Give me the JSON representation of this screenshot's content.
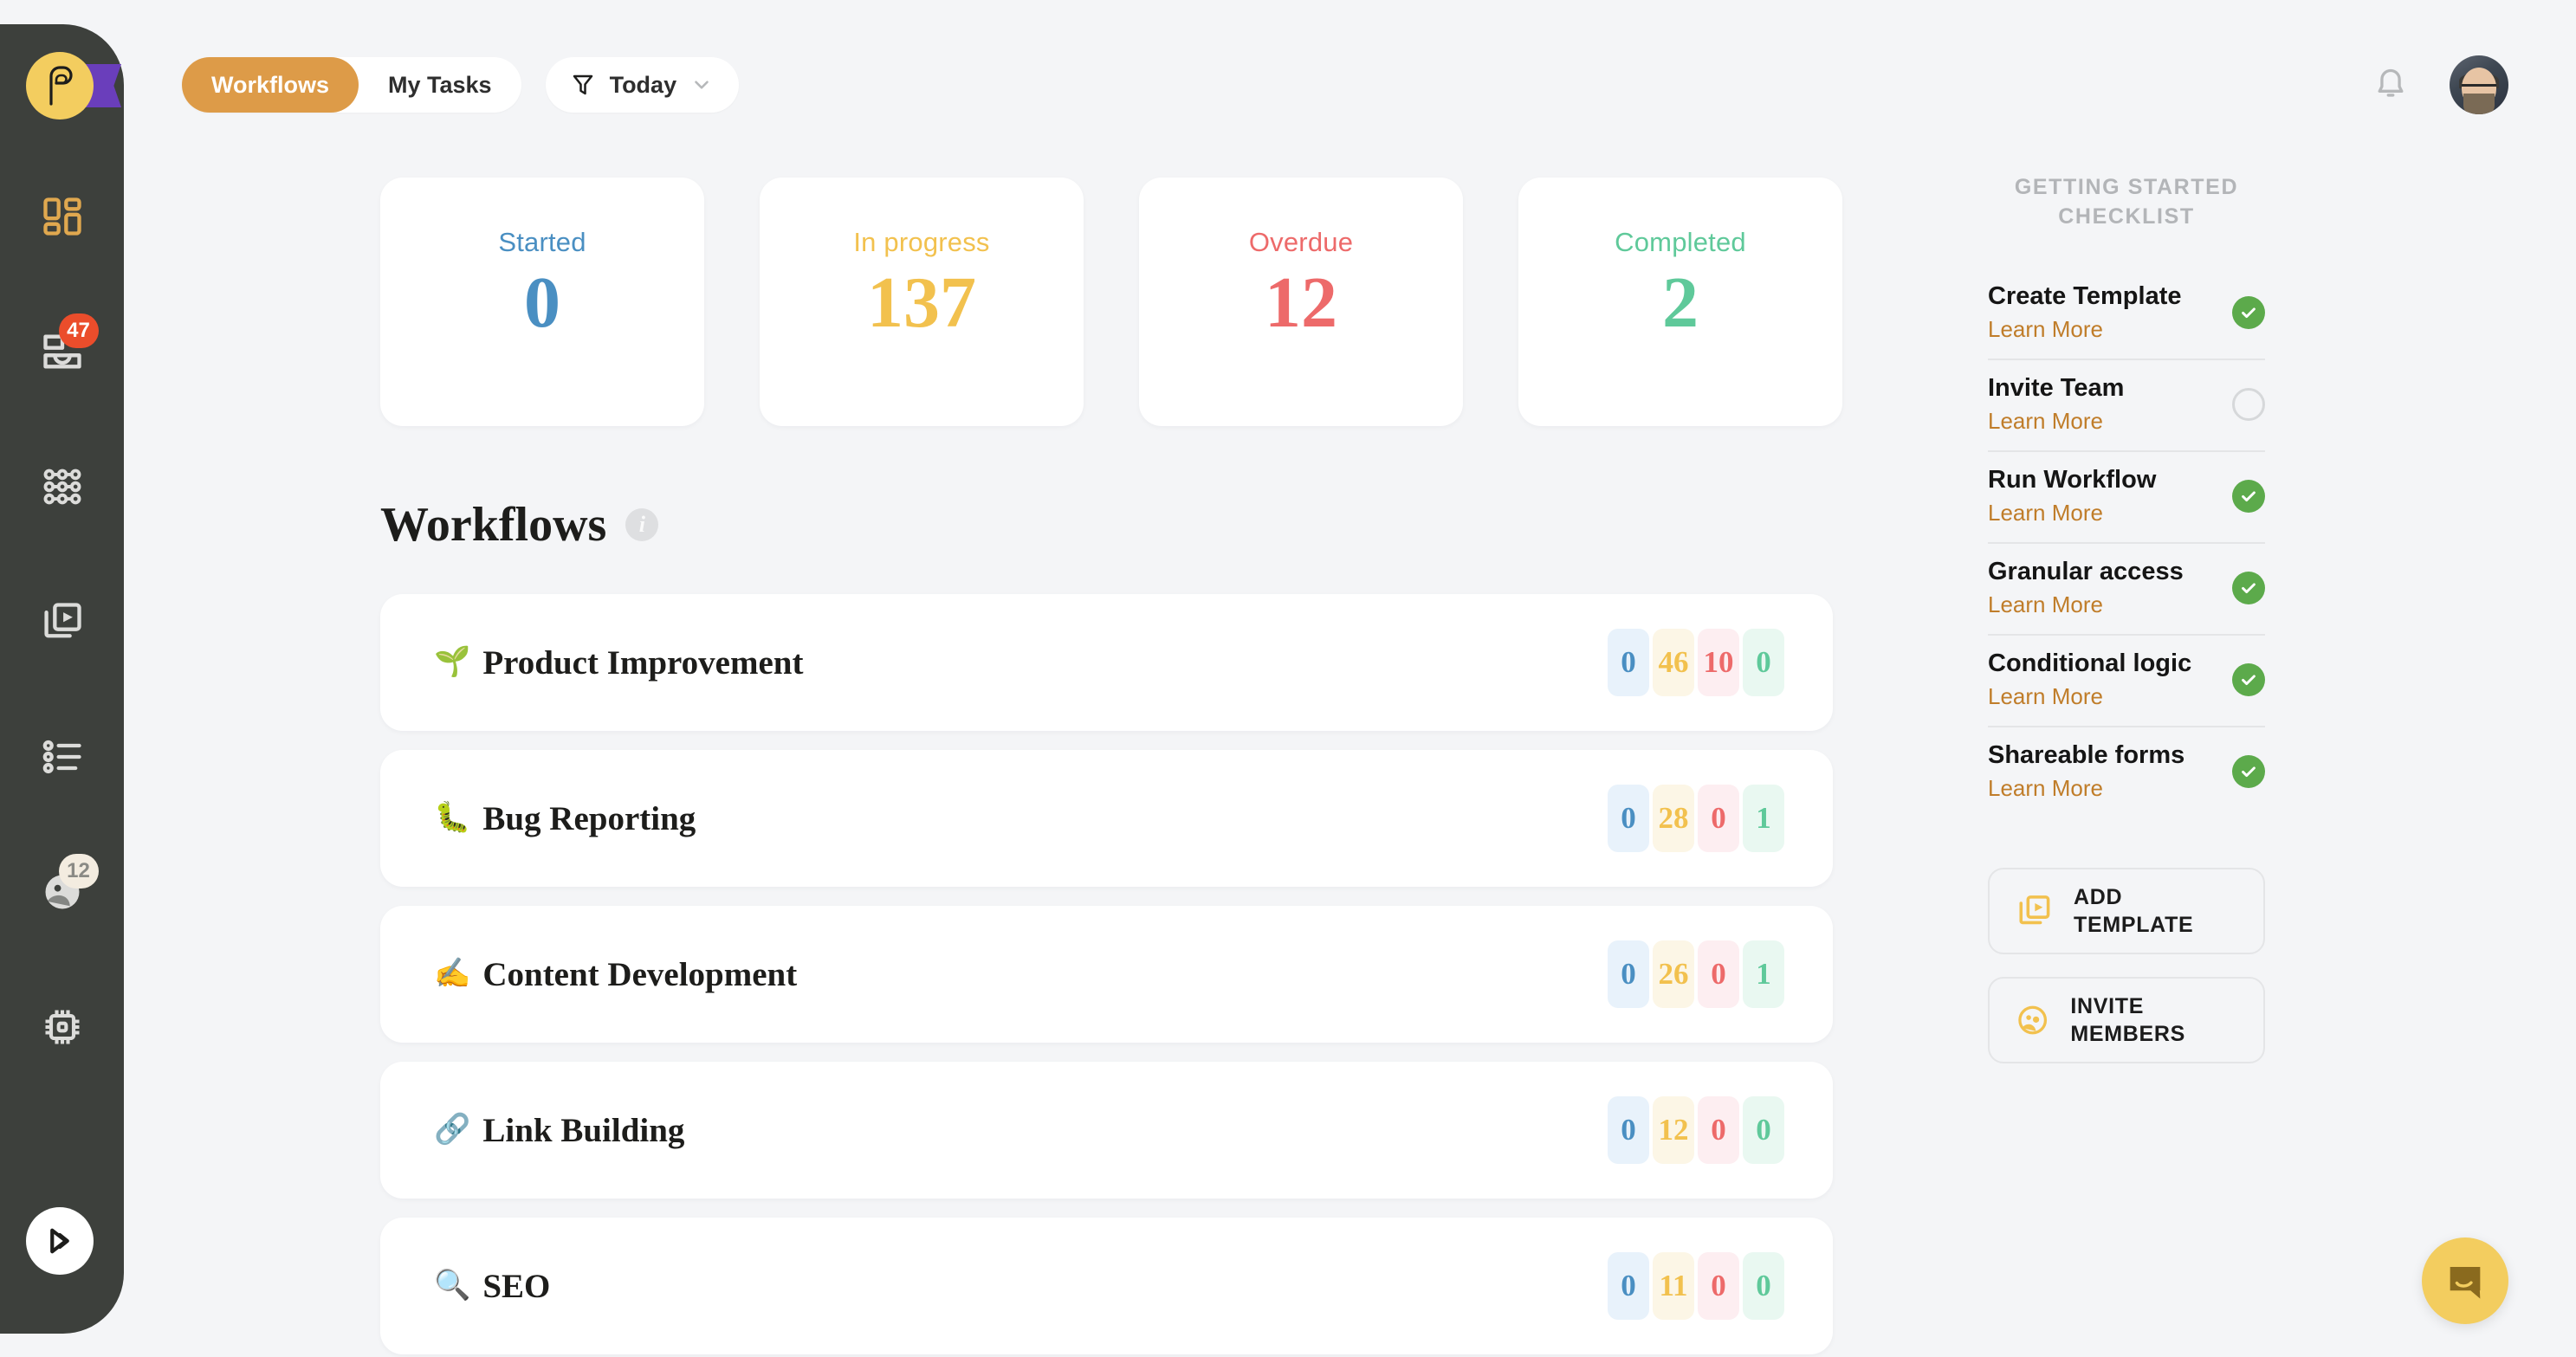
{
  "colors": {
    "sidebar_bg": "#3d403c",
    "page_bg": "#f4f5f7",
    "accent_orange": "#dd9b48",
    "logo_yellow": "#f3cd5f",
    "logo_purple": "#6a3ebb",
    "badge_red": "#eb4d2b",
    "started_blue": "#4a8fc2",
    "inprogress_yellow": "#f2c14e",
    "overdue_red": "#ed6a6a",
    "completed_green": "#5fc99a",
    "check_green": "#5caa4b",
    "link_brown": "#c07d2a"
  },
  "sidebar": {
    "logo": {
      "name": "process-street-logo",
      "letter": "P"
    },
    "items": [
      {
        "icon": "dashboard-grid-icon",
        "label": "Dashboard",
        "active": true,
        "badge": null
      },
      {
        "icon": "inbox-tasks-icon",
        "label": "Inbox",
        "active": false,
        "badge": "47"
      },
      {
        "icon": "workflow-nodes-icon",
        "label": "Workflows",
        "active": false,
        "badge": null
      },
      {
        "icon": "templates-play-icon",
        "label": "Templates",
        "active": false,
        "badge": null
      },
      {
        "icon": "checklist-icon",
        "label": "Checklists",
        "active": false,
        "badge": null
      },
      {
        "icon": "forms-globe-icon",
        "label": "Forms",
        "active": false,
        "badge": "12"
      },
      {
        "icon": "automation-chip-icon",
        "label": "Automations",
        "active": false,
        "badge": null
      }
    ],
    "fab": {
      "icon": "run-play-icon",
      "label": "Run"
    }
  },
  "topbar": {
    "tabs": [
      {
        "label": "Workflows",
        "active": true
      },
      {
        "label": "My Tasks",
        "active": false
      }
    ],
    "filter": {
      "icon": "filter-funnel-icon",
      "label": "Today",
      "chevron": "chevron-down-icon"
    },
    "notifications_icon": "bell-icon",
    "avatar": "user-avatar"
  },
  "stats": [
    {
      "label": "Started",
      "value": "0",
      "color": "#4a8fc2"
    },
    {
      "label": "In progress",
      "value": "137",
      "color": "#f2c14e"
    },
    {
      "label": "Overdue",
      "value": "12",
      "color": "#ed6a6a"
    },
    {
      "label": "Completed",
      "value": "2",
      "color": "#5fc99a"
    }
  ],
  "section": {
    "title": "Workflows",
    "info_icon": "info-icon",
    "info_glyph": "i"
  },
  "workflows": {
    "count_colors": [
      {
        "bg": "#e8f2fb",
        "fg": "#4a8fc2"
      },
      {
        "bg": "#fcf6e6",
        "fg": "#f2c14e"
      },
      {
        "bg": "#fdeef1",
        "fg": "#ed6a6a"
      },
      {
        "bg": "#e9f8f1",
        "fg": "#5fc99a"
      }
    ],
    "rows": [
      {
        "emoji": "🌱",
        "emoji_name": "seedling-emoji",
        "name": "Product Improvement",
        "counts": [
          "0",
          "46",
          "10",
          "0"
        ]
      },
      {
        "emoji": "🐛",
        "emoji_name": "bug-emoji",
        "name": "Bug Reporting",
        "counts": [
          "0",
          "28",
          "0",
          "1"
        ]
      },
      {
        "emoji": "✍️",
        "emoji_name": "writing-hand-emoji",
        "name": "Content Development",
        "counts": [
          "0",
          "26",
          "0",
          "1"
        ]
      },
      {
        "emoji": "🔗",
        "emoji_name": "link-emoji",
        "name": "Link Building",
        "counts": [
          "0",
          "12",
          "0",
          "0"
        ]
      },
      {
        "emoji": "🔍",
        "emoji_name": "magnifier-emoji",
        "name": "SEO",
        "counts": [
          "0",
          "11",
          "0",
          "0"
        ]
      }
    ]
  },
  "checklist": {
    "title": "GETTING STARTED CHECKLIST",
    "learn_more": "Learn More",
    "items": [
      {
        "label": "Create Template",
        "done": true
      },
      {
        "label": "Invite Team",
        "done": false
      },
      {
        "label": "Run Workflow",
        "done": true
      },
      {
        "label": "Granular access",
        "done": true
      },
      {
        "label": "Conditional logic",
        "done": true
      },
      {
        "label": "Shareable forms",
        "done": true
      }
    ]
  },
  "panel_actions": [
    {
      "icon": "add-template-icon",
      "label": "ADD TEMPLATE"
    },
    {
      "icon": "invite-members-icon",
      "label": "INVITE MEMBERS"
    }
  ],
  "chat": {
    "icon": "chat-bubble-icon",
    "label": "Open chat"
  }
}
